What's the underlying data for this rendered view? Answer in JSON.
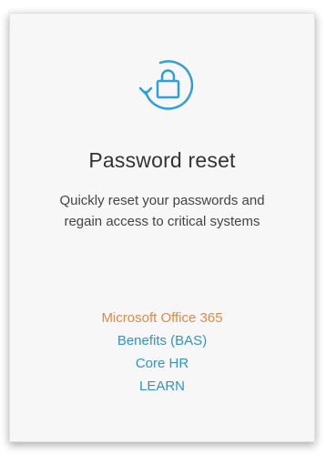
{
  "card": {
    "icon": "lock-reset-icon",
    "title": "Password reset",
    "description": "Quickly reset your passwords and regain access to critical systems",
    "links": [
      {
        "label": "Microsoft Office 365",
        "color": "#e0894a"
      },
      {
        "label": "Benefits (BAS)",
        "color": "#2f94cc"
      },
      {
        "label": "Core HR",
        "color": "#2f94cc"
      },
      {
        "label": "LEARN",
        "color": "#2f94cc"
      }
    ]
  },
  "colors": {
    "accent": "#2f9fd6"
  }
}
